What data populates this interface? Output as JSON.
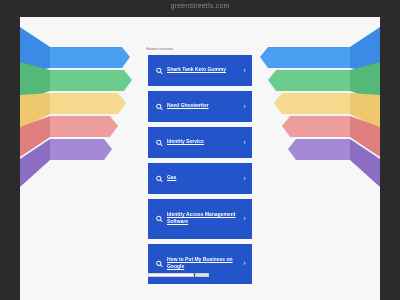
{
  "domain_title": "greenstreetls.com",
  "related_label": "Related searches",
  "links": [
    {
      "label": "Shark Tank Keto Gummy"
    },
    {
      "label": "Need Ghostwriter"
    },
    {
      "label": "Identity Service"
    },
    {
      "label": "Gas"
    },
    {
      "label": "Identity Access Management Software"
    },
    {
      "label": "How to Put My Business on Google"
    }
  ],
  "colors": {
    "link_background": "#2454c9",
    "page_background": "#f7f7f7",
    "frame": "#2b2b2b",
    "ribbons": [
      "#4a9ff2",
      "#6ccc8c",
      "#f6d98c",
      "#ee9d9d",
      "#a389d6"
    ]
  }
}
